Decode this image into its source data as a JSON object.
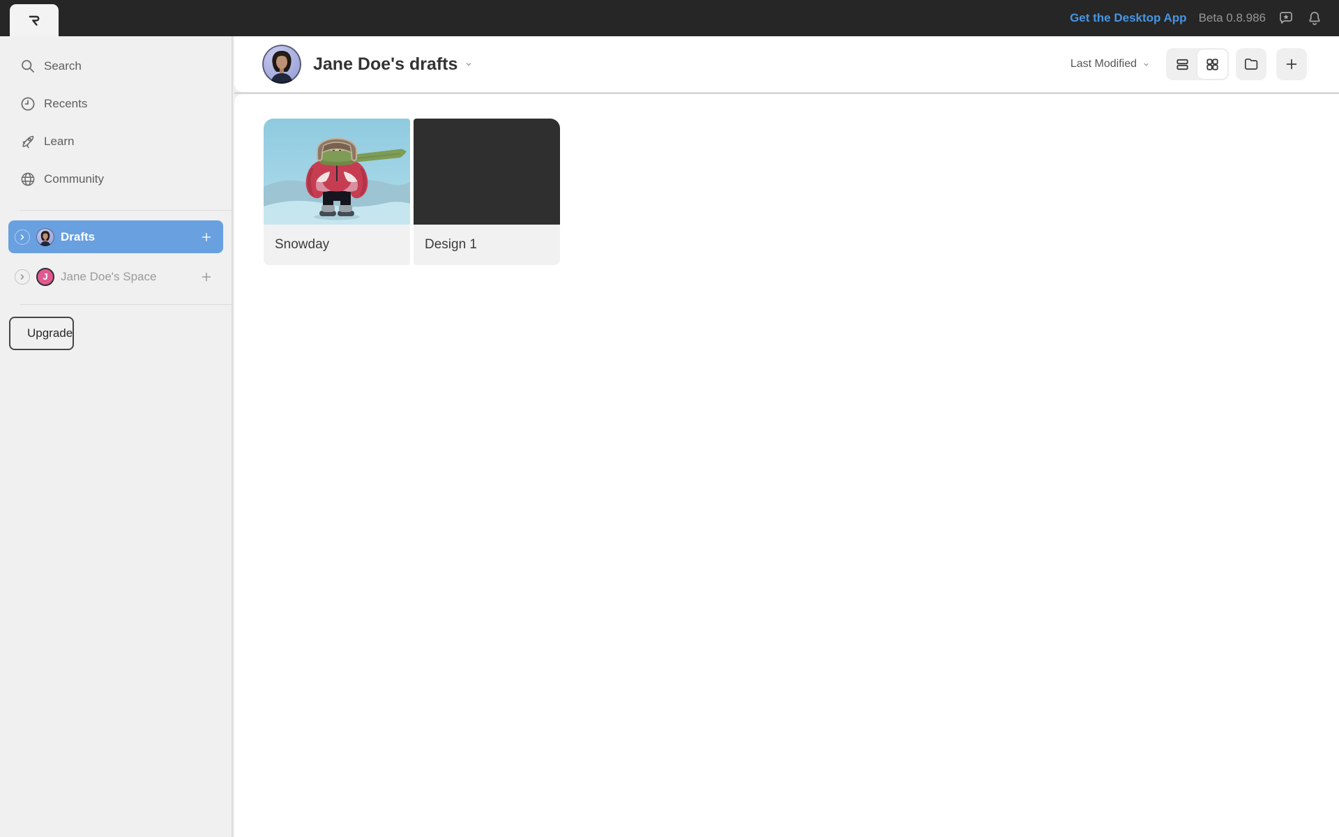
{
  "topbar": {
    "logo": "rive-logo",
    "desktop_app_link": "Get the Desktop App",
    "beta_label": "Beta 0.8.986",
    "icons": [
      "feedback-bubble-star-icon",
      "notifications-bell-icon"
    ]
  },
  "sidebar": {
    "items": [
      {
        "label": "Search",
        "icon": "search-icon"
      },
      {
        "label": "Recents",
        "icon": "clock-icon"
      },
      {
        "label": "Learn",
        "icon": "rocket-icon"
      },
      {
        "label": "Community",
        "icon": "globe-icon"
      }
    ],
    "spaces": [
      {
        "label": "Drafts",
        "selected": true,
        "avatar": "jane-doe-photo"
      },
      {
        "label": "Jane Doe's Space",
        "selected": false,
        "avatar_initial": "J"
      }
    ],
    "upgrade_label": "Upgrade"
  },
  "header": {
    "title": "Jane Doe's drafts",
    "avatar": "jane-doe-photo",
    "sort_label": "Last Modified",
    "view_mode": "grid"
  },
  "files": [
    {
      "name": "Snowday",
      "thumbnail": "snowday-winter-character-illustration"
    },
    {
      "name": "Design 1",
      "thumbnail": "dark-empty-canvas"
    }
  ],
  "colors": {
    "topbar_bg": "#262626",
    "selected_space_blue": "#68A0E0",
    "link_blue": "#4796E2",
    "space_pink": "#E2598E",
    "design1_thumbnail": "#2F2F2F",
    "sidebar_bg": "#F0F0F0"
  }
}
